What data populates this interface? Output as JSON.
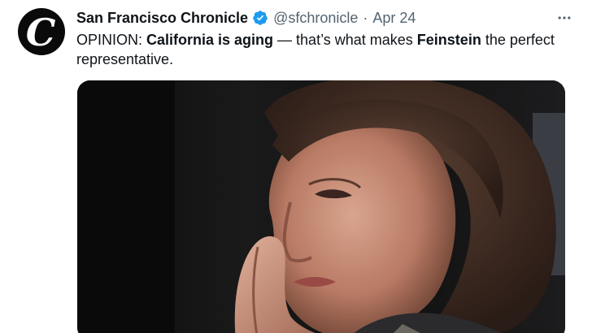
{
  "account": {
    "display_name": "San Francisco Chronicle",
    "handle": "@sfchronicle",
    "separator": "·",
    "date": "Apr 24",
    "avatar_letter": "C",
    "verified": true,
    "verified_color": "#1d9bf0"
  },
  "tweet": {
    "prefix": "OPINION: ",
    "bold_1": "California is aging",
    "middle": " — that’s what makes ",
    "bold_2": "Feinstein",
    "suffix": " the perfect representative."
  },
  "icons": {
    "more": "more-horizontal-icon",
    "verified": "verified-badge-icon"
  },
  "media": {
    "kind": "photo",
    "description_icon": "photo"
  }
}
